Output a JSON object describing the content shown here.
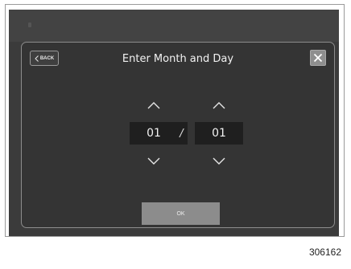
{
  "dialog": {
    "title": "Enter Month and Day",
    "back_label": "BACK",
    "ok_label": "OK"
  },
  "date_picker": {
    "month": "01",
    "separator": "/",
    "day": "01"
  },
  "icons": {
    "back": "chevron-left-icon",
    "close": "close-icon",
    "increment": "chevron-up-icon",
    "decrement": "chevron-down-icon"
  },
  "figure_number": "306162"
}
